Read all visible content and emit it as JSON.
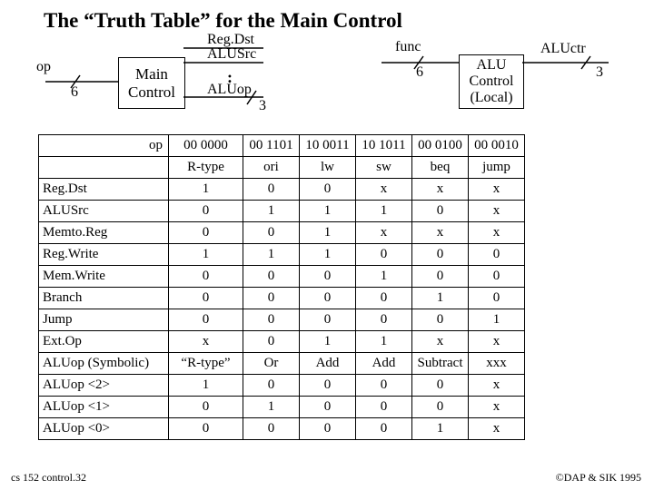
{
  "title": "The “Truth Table” for the Main Control",
  "diagram": {
    "op_label": "op",
    "op_width": "6",
    "main_control_line1": "Main",
    "main_control_line2": "Control",
    "regdst": "Reg.Dst",
    "alusrc": "ALUSrc",
    "aluop": "ALUop",
    "aluop_width": "3",
    "func_label": "func",
    "func_width": "6",
    "alu_control_line1": "ALU",
    "alu_control_line2": "Control",
    "alu_control_line3": "(Local)",
    "aluctr": "ALUctr",
    "aluctr_width": "3"
  },
  "table": {
    "top_left": "op",
    "opcodes": [
      "00 0000",
      "00 1101",
      "10 0011",
      "10 1011",
      "00 0100",
      "00 0010"
    ],
    "second_left": "",
    "types": [
      "R-type",
      "ori",
      "lw",
      "sw",
      "beq",
      "jump"
    ],
    "rows": [
      {
        "name": "Reg.Dst",
        "vals": [
          "1",
          "0",
          "0",
          "x",
          "x",
          "x"
        ]
      },
      {
        "name": "ALUSrc",
        "vals": [
          "0",
          "1",
          "1",
          "1",
          "0",
          "x"
        ]
      },
      {
        "name": "Memto.Reg",
        "vals": [
          "0",
          "0",
          "1",
          "x",
          "x",
          "x"
        ]
      },
      {
        "name": "Reg.Write",
        "vals": [
          "1",
          "1",
          "1",
          "0",
          "0",
          "0"
        ]
      },
      {
        "name": "Mem.Write",
        "vals": [
          "0",
          "0",
          "0",
          "1",
          "0",
          "0"
        ]
      },
      {
        "name": "Branch",
        "vals": [
          "0",
          "0",
          "0",
          "0",
          "1",
          "0"
        ]
      },
      {
        "name": "Jump",
        "vals": [
          "0",
          "0",
          "0",
          "0",
          "0",
          "1"
        ]
      },
      {
        "name": "Ext.Op",
        "vals": [
          "x",
          "0",
          "1",
          "1",
          "x",
          "x"
        ]
      },
      {
        "name": "ALUop (Symbolic)",
        "vals": [
          "“R-type”",
          "Or",
          "Add",
          "Add",
          "Subtract",
          "xxx"
        ]
      },
      {
        "name": "ALUop <2>",
        "vals": [
          "1",
          "0",
          "0",
          "0",
          "0",
          "x"
        ]
      },
      {
        "name": "ALUop <1>",
        "vals": [
          "0",
          "1",
          "0",
          "0",
          "0",
          "x"
        ]
      },
      {
        "name": "ALUop <0>",
        "vals": [
          "0",
          "0",
          "0",
          "0",
          "1",
          "x"
        ]
      }
    ]
  },
  "footer": {
    "left": "cs 152  control.32",
    "right": "©DAP & SIK 1995"
  }
}
